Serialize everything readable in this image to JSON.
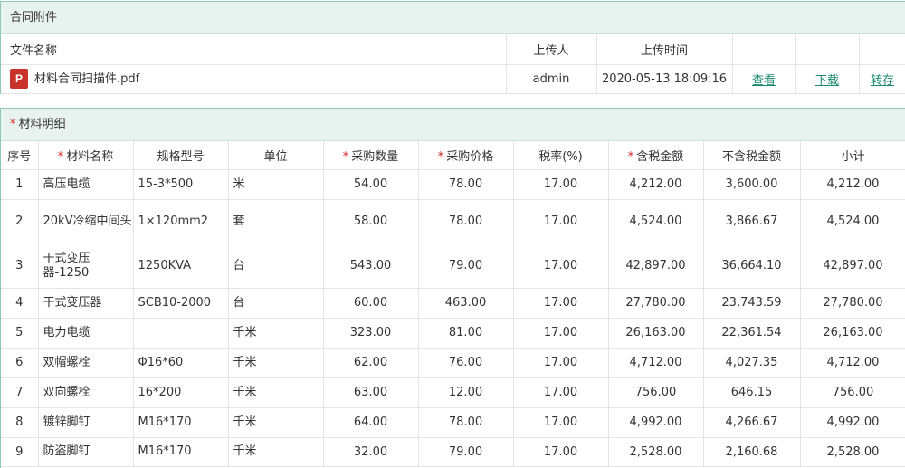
{
  "attachments": {
    "title": "合同附件",
    "columns": {
      "file_name": "文件名称",
      "uploader": "上传人",
      "upload_time": "上传时间"
    },
    "files": [
      {
        "icon": "pdf-file-icon",
        "icon_glyph": "P",
        "name": "材料合同扫描件.pdf",
        "uploader": "admin",
        "time": "2020-05-13 18:09:16",
        "actions": [
          "查看",
          "下载",
          "转存"
        ]
      }
    ]
  },
  "materials": {
    "title": "材料明细",
    "required_mark": "*",
    "columns": [
      {
        "label": "序号",
        "required": false
      },
      {
        "label": "材料名称",
        "required": true
      },
      {
        "label": "规格型号",
        "required": false
      },
      {
        "label": "单位",
        "required": false
      },
      {
        "label": "采购数量",
        "required": true
      },
      {
        "label": "采购价格",
        "required": true
      },
      {
        "label": "税率(%)",
        "required": false
      },
      {
        "label": "含税金额",
        "required": true
      },
      {
        "label": "不含税金额",
        "required": false
      },
      {
        "label": "小计",
        "required": false
      }
    ],
    "rows": [
      [
        "1",
        "高压电缆",
        "15-3*500",
        "米",
        "54.00",
        "78.00",
        "17.00",
        "4,212.00",
        "3,600.00",
        "4,212.00"
      ],
      [
        "2",
        "20kV冷缩中间头",
        "1×120mm2",
        "套",
        "58.00",
        "78.00",
        "17.00",
        "4,524.00",
        "3,866.67",
        "4,524.00"
      ],
      [
        "3",
        "干式变压器-1250",
        "1250KVA",
        "台",
        "543.00",
        "79.00",
        "17.00",
        "42,897.00",
        "36,664.10",
        "42,897.00"
      ],
      [
        "4",
        "干式变压器",
        "SCB10-2000",
        "台",
        "60.00",
        "463.00",
        "17.00",
        "27,780.00",
        "23,743.59",
        "27,780.00"
      ],
      [
        "5",
        "电力电缆",
        "",
        "千米",
        "323.00",
        "81.00",
        "17.00",
        "26,163.00",
        "22,361.54",
        "26,163.00"
      ],
      [
        "6",
        "双帽螺栓",
        "Φ16*60",
        "千米",
        "62.00",
        "76.00",
        "17.00",
        "4,712.00",
        "4,027.35",
        "4,712.00"
      ],
      [
        "7",
        "双向螺栓",
        "16*200",
        "千米",
        "63.00",
        "12.00",
        "17.00",
        "756.00",
        "646.15",
        "756.00"
      ],
      [
        "8",
        "镀锌脚钉",
        "M16*170",
        "千米",
        "64.00",
        "78.00",
        "17.00",
        "4,992.00",
        "4,266.67",
        "4,992.00"
      ],
      [
        "9",
        "防盗脚钉",
        "M16*170",
        "千米",
        "32.00",
        "79.00",
        "17.00",
        "2,528.00",
        "2,160.68",
        "2,528.00"
      ]
    ]
  },
  "colors": {
    "accent": "#1a8a6a",
    "header_bg": "#e8f3f0",
    "border": "#8ec9b5",
    "required": "#e02020",
    "pdf_icon": "#c8342b"
  }
}
